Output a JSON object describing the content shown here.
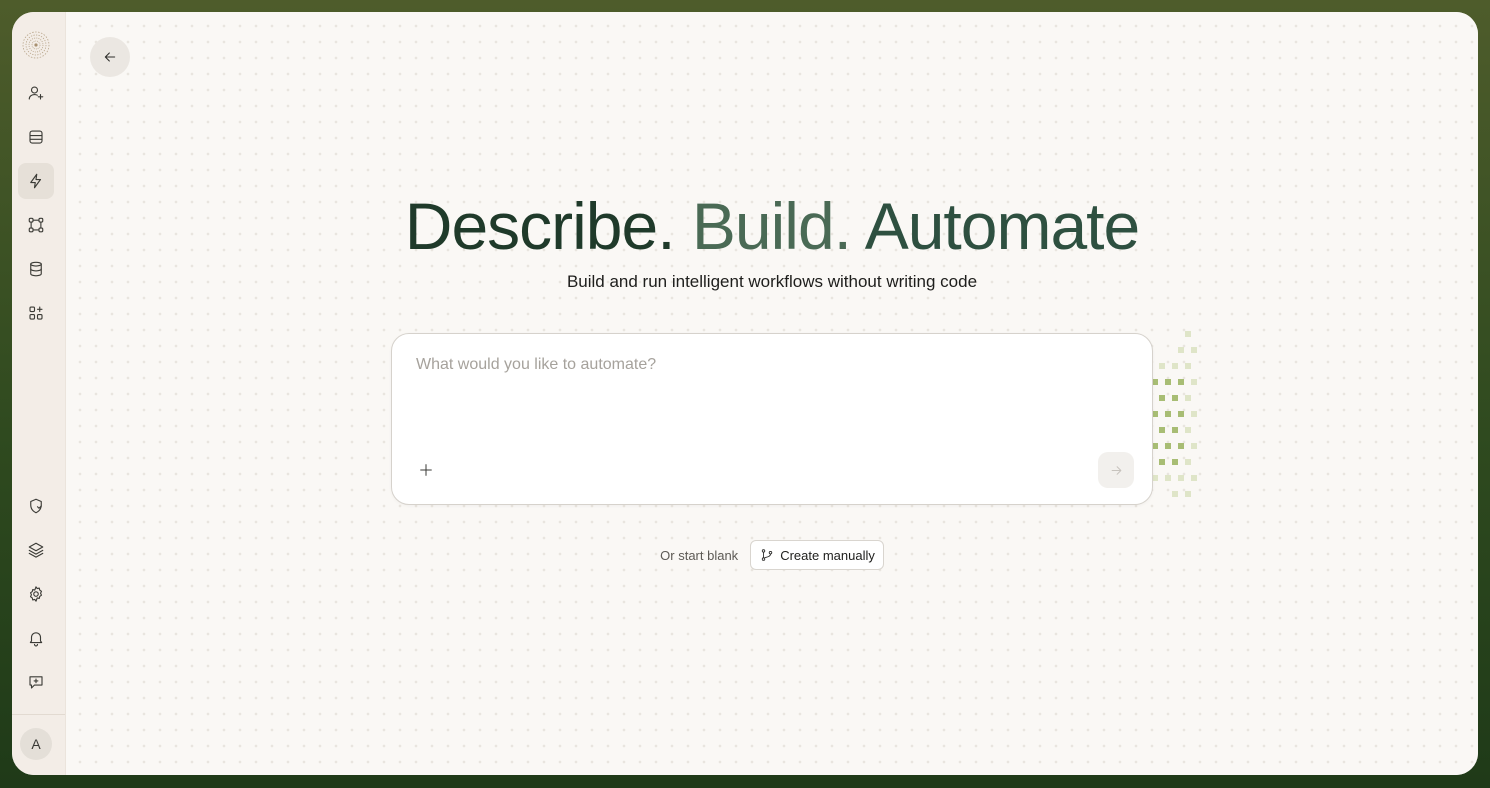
{
  "sidebar": {
    "logo": "spiral-logo",
    "top_items": [
      {
        "id": "contacts",
        "icon": "user-plus-icon"
      },
      {
        "id": "tables",
        "icon": "table-icon"
      },
      {
        "id": "automations",
        "icon": "lightning-icon",
        "active": true
      },
      {
        "id": "workflows",
        "icon": "workflow-nodes-icon"
      },
      {
        "id": "database",
        "icon": "database-icon"
      },
      {
        "id": "apps",
        "icon": "apps-add-icon"
      }
    ],
    "bottom_items": [
      {
        "id": "security",
        "icon": "shield-icon"
      },
      {
        "id": "layers",
        "icon": "layers-icon"
      },
      {
        "id": "settings",
        "icon": "gear-icon"
      },
      {
        "id": "notifications",
        "icon": "bell-icon"
      },
      {
        "id": "feedback",
        "icon": "chat-plus-icon"
      }
    ],
    "avatar_initial": "A"
  },
  "header": {
    "back_icon": "arrow-left-icon"
  },
  "hero": {
    "title_part1": "Describe.",
    "title_part2": "Build.",
    "title_part3": "Automate",
    "subtitle": "Build and run intelligent workflows without writing code"
  },
  "prompt": {
    "placeholder": "What would you like to automate?",
    "value": "",
    "attach_icon": "plus-icon",
    "send_icon": "arrow-right-icon"
  },
  "start_blank": {
    "label": "Or start blank",
    "button_label": "Create manually",
    "button_icon": "git-branch-icon"
  },
  "colors": {
    "frame_green": "#2f4a1f",
    "sidebar_bg": "#f3ede7",
    "page_bg": "#faf8f5",
    "title_dark": "#1f3a2a",
    "title_mid": "#4a6a55",
    "accent_pattern": "#9db36a"
  }
}
